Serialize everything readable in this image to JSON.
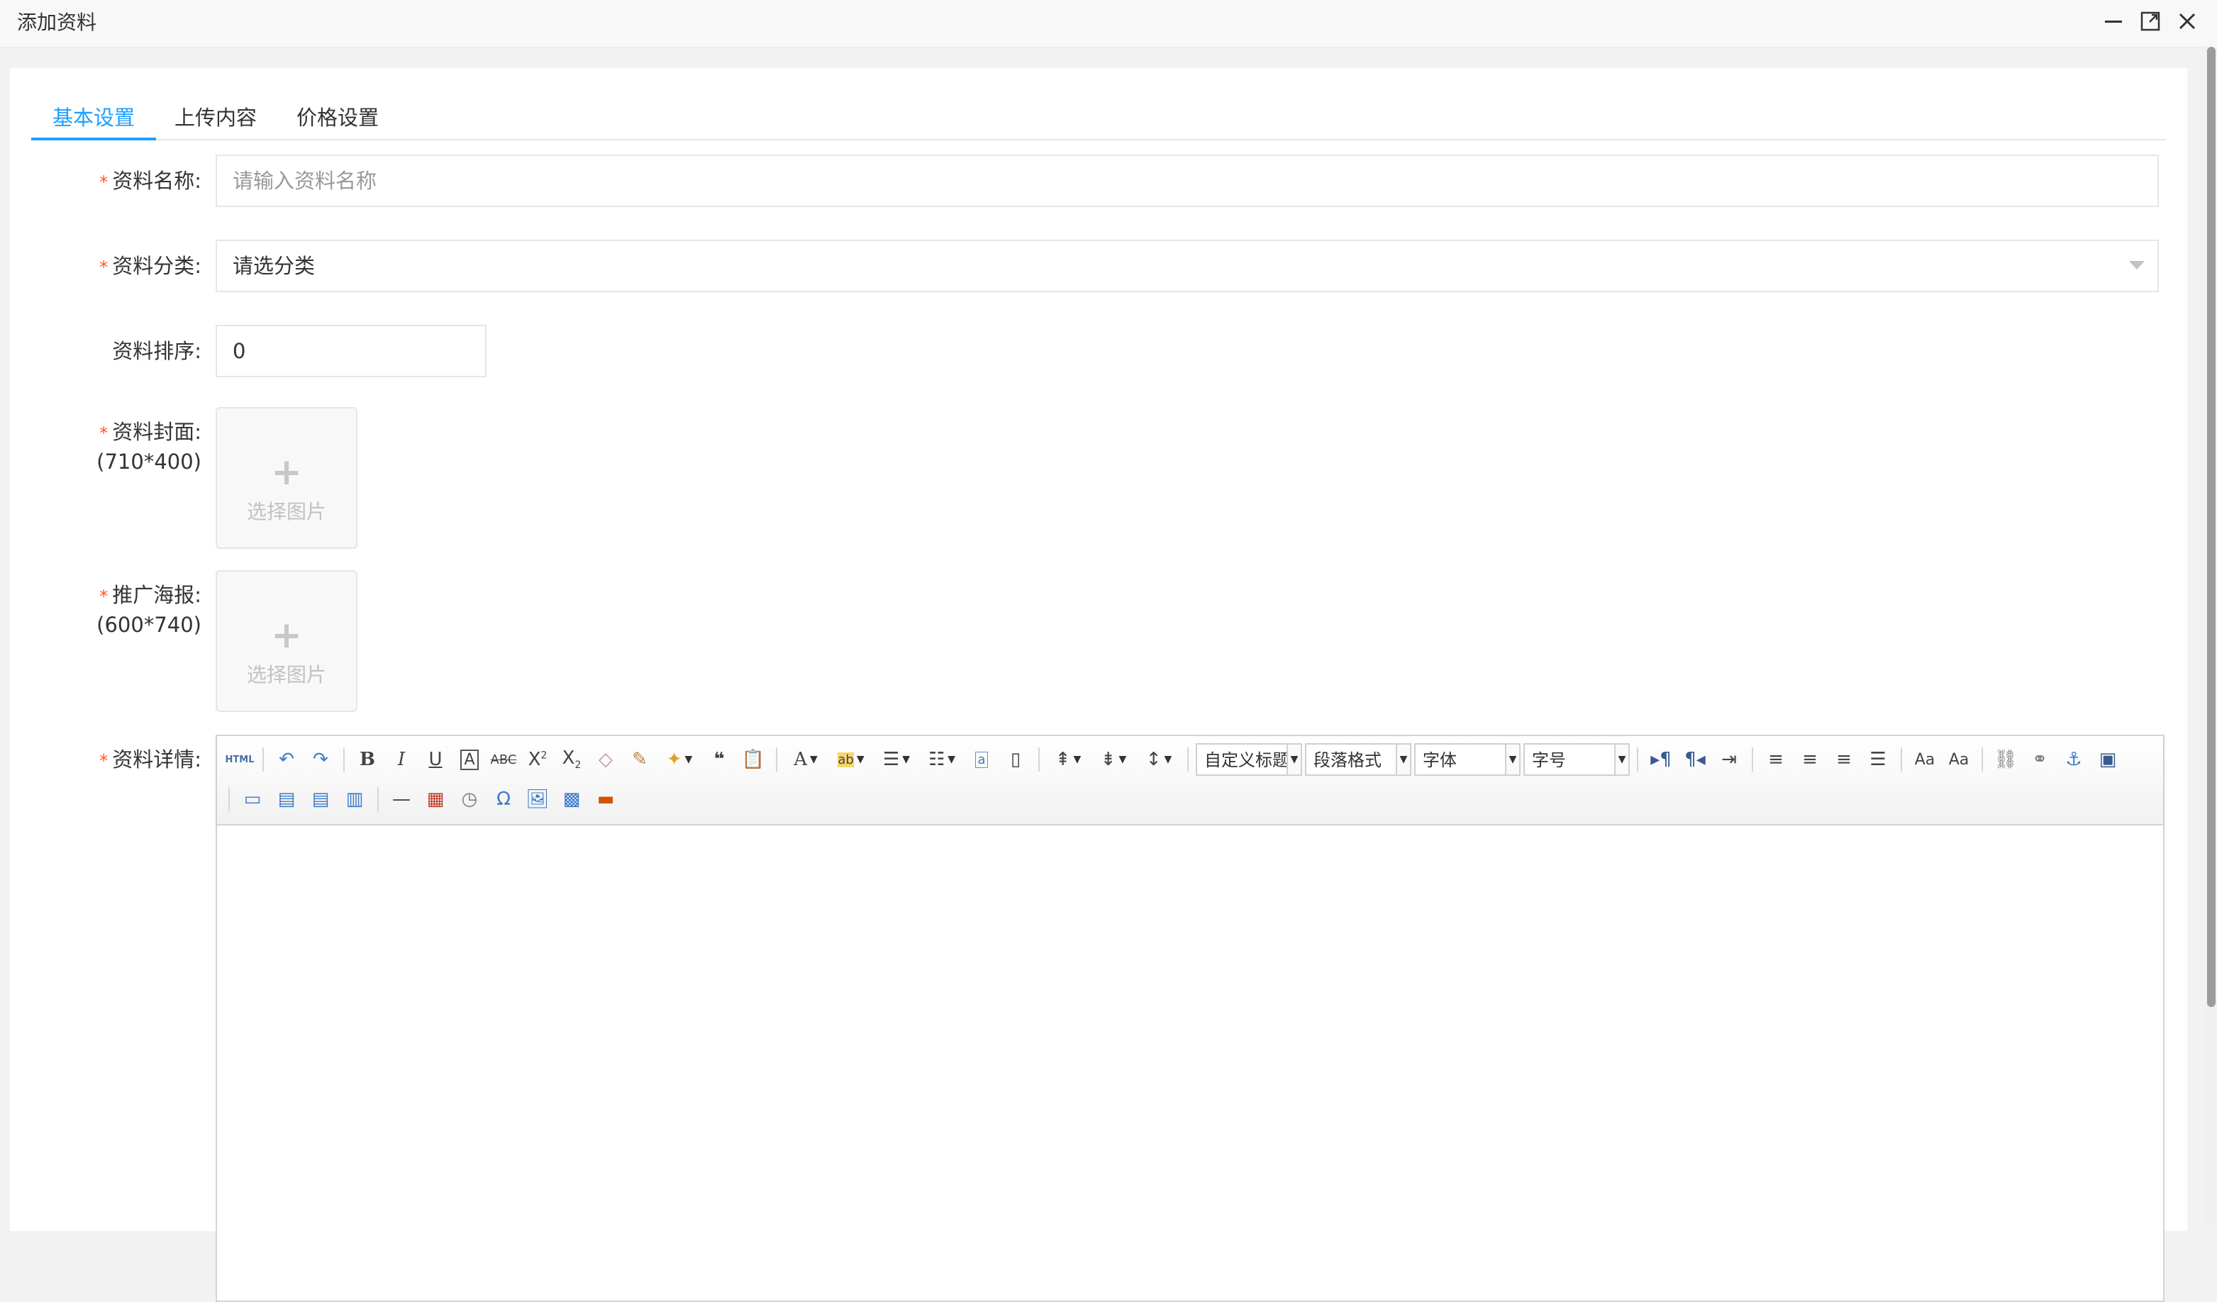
{
  "window": {
    "title": "添加资料"
  },
  "tabs": [
    {
      "label": "基本设置",
      "active": true
    },
    {
      "label": "上传内容",
      "active": false
    },
    {
      "label": "价格设置",
      "active": false
    }
  ],
  "form": {
    "name": {
      "label": "资料名称:",
      "placeholder": "请输入资料名称",
      "required": true
    },
    "category": {
      "label": "资料分类:",
      "value": "请选分类",
      "required": true
    },
    "sort": {
      "label": "资料排序:",
      "value": "0",
      "required": false
    },
    "cover": {
      "label": "资料封面:",
      "hint": "(710*400)",
      "button": "选择图片",
      "required": true
    },
    "poster": {
      "label": "推广海报:",
      "hint": "(600*740)",
      "button": "选择图片",
      "required": true
    },
    "detail": {
      "label": "资料详情:",
      "required": true
    }
  },
  "editor": {
    "html_label": "HTML",
    "combos": {
      "custom_title": "自定义标题",
      "paragraph": "段落格式",
      "font_family": "字体",
      "font_size": "字号"
    }
  },
  "colors": {
    "accent": "#1e9fff",
    "required": "#ff5722"
  }
}
